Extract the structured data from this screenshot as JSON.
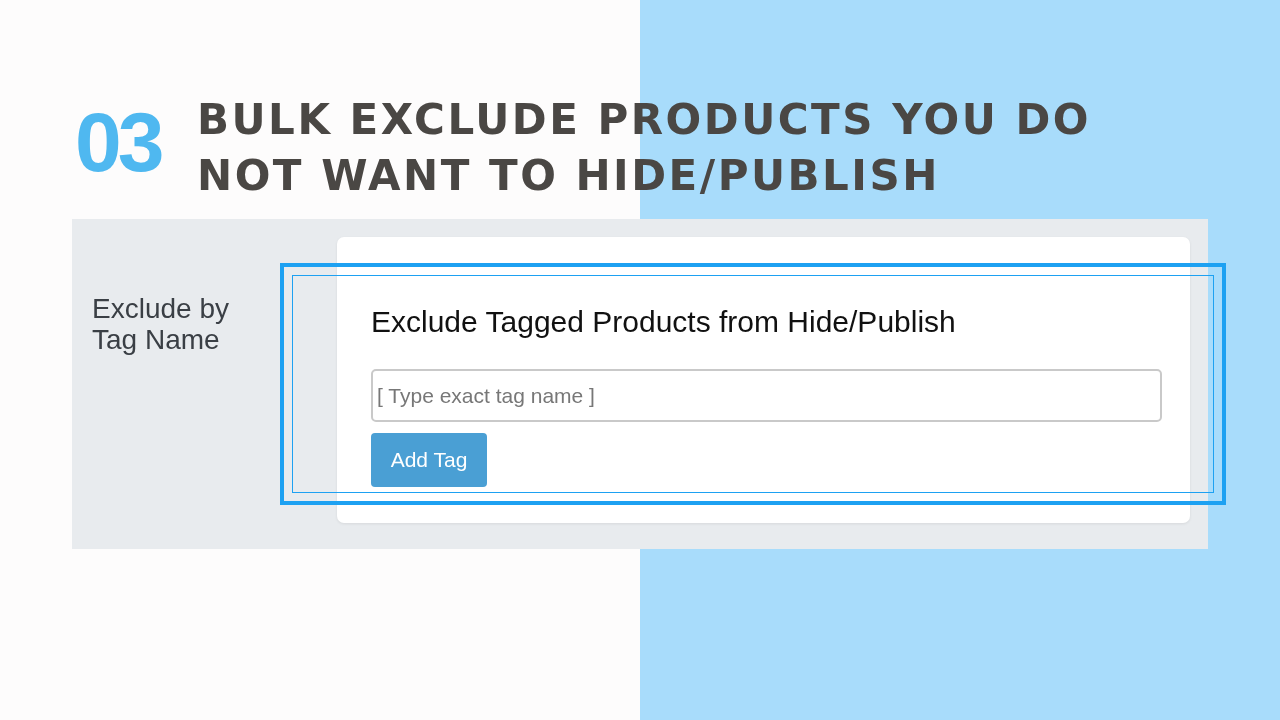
{
  "step_number": "03",
  "headline": "BULK EXCLUDE PRODUCTS YOU DO NOT WANT TO HIDE/PUBLISH",
  "settings_panel": {
    "label": "Exclude by Tag Name",
    "card": {
      "title": "Exclude Tagged Products from Hide/Publish",
      "tag_field": {
        "placeholder": "[ Type exact tag name ]"
      },
      "button": "Add Tag"
    }
  }
}
